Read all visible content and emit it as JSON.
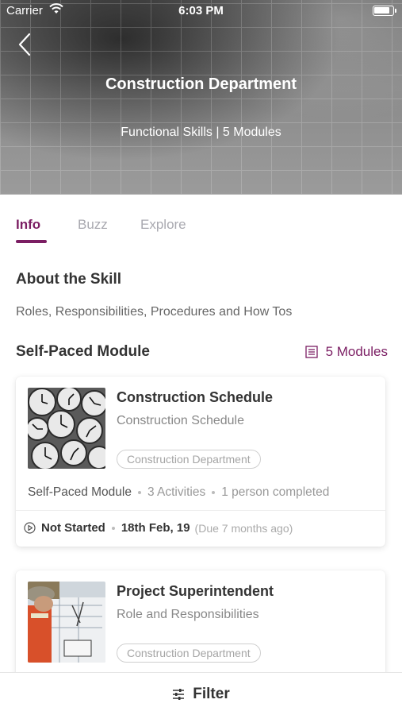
{
  "status_bar": {
    "carrier": "Carrier",
    "time": "6:03 PM"
  },
  "header": {
    "title": "Construction Department",
    "subtitle": "Functional Skills | 5 Modules"
  },
  "tabs": [
    {
      "label": "Info",
      "active": true
    },
    {
      "label": "Buzz",
      "active": false
    },
    {
      "label": "Explore",
      "active": false
    }
  ],
  "about": {
    "heading": "About the Skill",
    "text": "Roles, Responsibilities, Procedures and How Tos"
  },
  "modules_section": {
    "heading": "Self-Paced Module",
    "count_label": "5 Modules"
  },
  "cards": [
    {
      "title": "Construction Schedule",
      "subtitle": "Construction Schedule",
      "tag": "Construction Department",
      "type": "Self-Paced Module",
      "activities": "3 Activities",
      "completed": "1 person completed",
      "status": "Not Started",
      "date": "18th Feb, 19",
      "due": "(Due 7 months ago)"
    },
    {
      "title": "Project Superintendent",
      "subtitle": "Role and Responsibilities",
      "tag": "Construction Department"
    }
  ],
  "bottom_bar": {
    "filter_label": "Filter"
  },
  "colors": {
    "accent": "#7b1e63",
    "text": "#333333",
    "muted": "#999999"
  }
}
